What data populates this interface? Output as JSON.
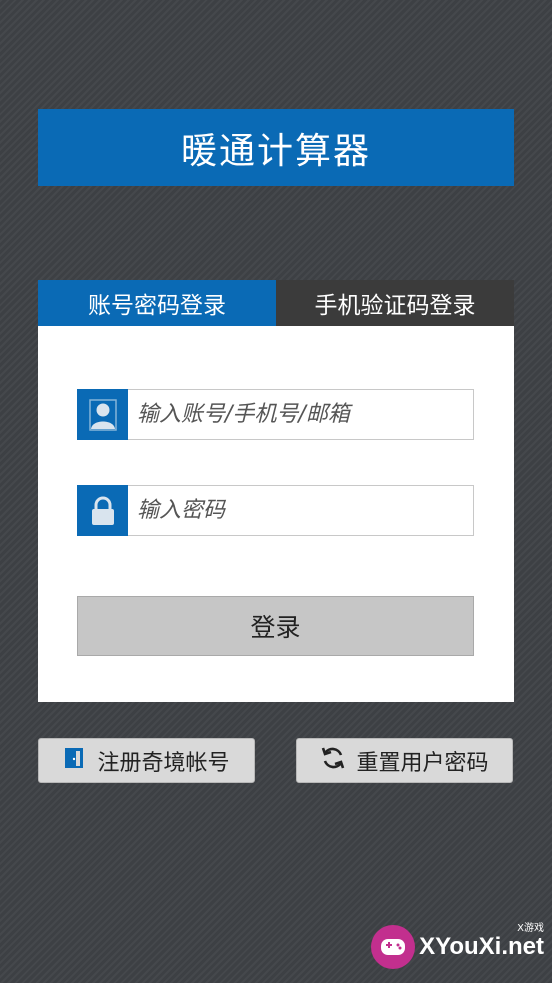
{
  "app": {
    "title": "暖通计算器"
  },
  "tabs": [
    {
      "label": "账号密码登录",
      "active": true
    },
    {
      "label": "手机验证码登录",
      "active": false
    }
  ],
  "form": {
    "account": {
      "placeholder": "输入账号/手机号/邮箱",
      "value": "",
      "icon": "user-icon"
    },
    "password": {
      "placeholder": "输入密码",
      "value": "",
      "icon": "lock-icon"
    },
    "login_label": "登录"
  },
  "actions": {
    "register_label": "注册奇境帐号",
    "register_icon": "door-icon",
    "reset_label": "重置用户密码",
    "reset_icon": "refresh-icon"
  },
  "watermark": {
    "text": "XYouXi.net",
    "small": "X游戏"
  },
  "colors": {
    "accent": "#0a6ab5",
    "background": "#3d4044",
    "tab_inactive": "#3b3b3b",
    "button": "#c6c6c6"
  }
}
